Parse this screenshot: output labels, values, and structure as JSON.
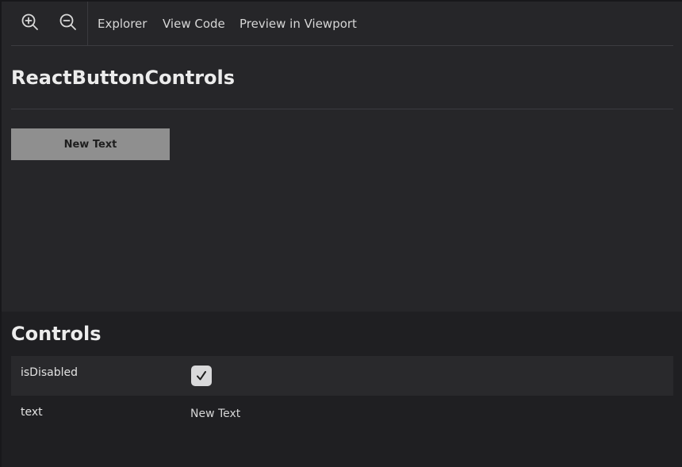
{
  "toolbar": {
    "zoom_in_icon": "zoom-in-icon",
    "zoom_out_icon": "zoom-out-icon",
    "links": {
      "explorer": "Explorer",
      "view_code": "View Code",
      "preview": "Preview in Viewport"
    }
  },
  "story": {
    "title": "ReactButtonControls",
    "button_label": "New Text",
    "button_disabled": true
  },
  "controls": {
    "title": "Controls",
    "rows": [
      {
        "label": "isDisabled",
        "type": "checkbox",
        "checked": true
      },
      {
        "label": "text",
        "type": "text",
        "value": "New Text"
      }
    ]
  },
  "colors": {
    "background": "#262629",
    "panel": "#1f1f22",
    "button_disabled_bg": "#8f8f8f",
    "checkbox_bg": "#d9d9db"
  }
}
